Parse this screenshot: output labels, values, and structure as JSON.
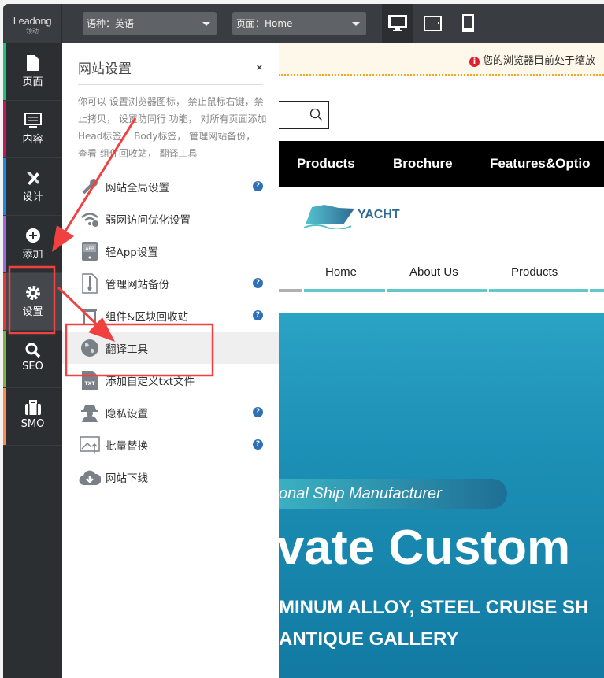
{
  "topbar": {
    "logo": "Leadong",
    "logo_sub": "领动",
    "language_select": "语种：英语",
    "page_select": "页面：Home",
    "devices": [
      "desktop-icon",
      "tablet-icon",
      "mobile-icon"
    ]
  },
  "sidebar": {
    "items": [
      {
        "label": "页面",
        "icon": "file-icon",
        "color": "#1fc37a"
      },
      {
        "label": "内容",
        "icon": "list-icon",
        "color": "#c2185b"
      },
      {
        "label": "设计",
        "icon": "design-tools-icon",
        "color": "#1e88e5"
      },
      {
        "label": "添加",
        "icon": "plus-circle-icon",
        "color": "#9c6ade"
      },
      {
        "label": "设置",
        "icon": "gear-icon",
        "color": "#e53935",
        "active": true
      },
      {
        "label": "SEO",
        "icon": "search-icon",
        "color": "#7cb342"
      },
      {
        "label": "SMO",
        "icon": "briefcase-icon",
        "color": "#ff8a50"
      }
    ]
  },
  "panel": {
    "title": "网站设置",
    "close": "×",
    "description": "你可以 设置浏览器图标， 禁止鼠标右键，禁止拷贝， 设置防同行 功能， 对所有页面添加 Head标签、 Body标签， 管理网站备份， 查看 组件回收站， 翻译工具",
    "items": [
      {
        "label": "网站全局设置",
        "icon": "wrench-icon",
        "help": "?"
      },
      {
        "label": "弱网访问优化设置",
        "icon": "wifi-icon"
      },
      {
        "label": "轻App设置",
        "icon": "app-icon"
      },
      {
        "label": "管理网站备份",
        "icon": "zip-file-icon",
        "help": "?"
      },
      {
        "label": "组件&区块回收站",
        "icon": "trash-icon",
        "help": "?"
      },
      {
        "label": "翻译工具",
        "icon": "globe-icon",
        "active": true
      },
      {
        "label": "添加自定义txt文件",
        "icon": "txt-file-icon"
      },
      {
        "label": "隐私设置",
        "icon": "spy-icon",
        "help": "?"
      },
      {
        "label": "批量替换",
        "icon": "image-replace-icon",
        "help": "?"
      },
      {
        "label": "网站下线",
        "icon": "cloud-download-icon"
      }
    ]
  },
  "site": {
    "notice": "您的浏览器目前处于缩放",
    "top_nav": [
      "Products",
      "Brochure",
      "Features&Optio"
    ],
    "brand": "YACHT",
    "main_nav": [
      "Home",
      "About Us",
      "Products"
    ],
    "hero": {
      "tagline": "onal Ship Manufacturer",
      "headline": "vate Custom",
      "sub1": "MINUM ALLOY, STEEL CRUISE SH",
      "sub2": "ANTIQUE GALLERY"
    }
  },
  "colors": {
    "annotation": "#f04040",
    "accent": "#64c7cc",
    "help": "#2f6fb5"
  }
}
